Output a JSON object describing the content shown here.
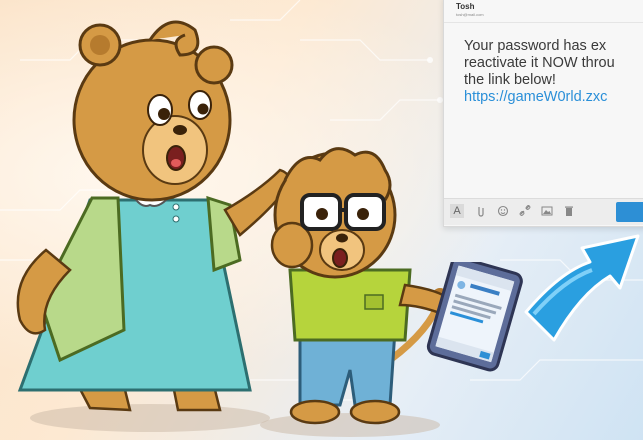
{
  "email": {
    "sender_name": "Tosh",
    "sender_email": "tosh@mail.com",
    "body_lines": [
      "Your password has ex",
      "reactivate it NOW throu",
      "the link below!"
    ],
    "link": "https://gameW0rld.zxc"
  },
  "toolbar": {
    "format_label": "A",
    "icons": [
      "attach-icon",
      "emoji-icon",
      "link-icon",
      "image-icon",
      "trash-icon"
    ],
    "send_color": "#2d8fd5"
  },
  "colors": {
    "bear_fur": "#d59a45",
    "dress_teal": "#6fcfcf",
    "cardigan_green": "#b8d98a",
    "boy_shirt": "#b6d43c",
    "boy_pants": "#6fb1d6",
    "arrow_blue": "#2a9fe0"
  }
}
